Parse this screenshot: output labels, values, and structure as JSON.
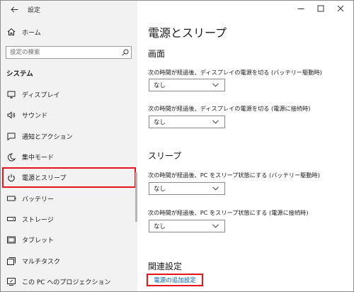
{
  "window": {
    "title": "設定"
  },
  "sidebar": {
    "home_label": "ホーム",
    "search_placeholder": "設定の検索",
    "section_heading": "システム",
    "items": [
      {
        "label": "ディスプレイ",
        "icon": "display-icon"
      },
      {
        "label": "サウンド",
        "icon": "speaker-icon"
      },
      {
        "label": "通知とアクション",
        "icon": "notification-icon"
      },
      {
        "label": "集中モード",
        "icon": "moon-icon"
      },
      {
        "label": "電源とスリープ",
        "icon": "power-icon",
        "selected": true
      },
      {
        "label": "バッテリー",
        "icon": "battery-icon"
      },
      {
        "label": "ストレージ",
        "icon": "storage-icon"
      },
      {
        "label": "タブレット",
        "icon": "tablet-icon"
      },
      {
        "label": "マルチタスク",
        "icon": "multitask-icon"
      },
      {
        "label": "この PC へのプロジェクション",
        "icon": "projection-icon"
      }
    ]
  },
  "main": {
    "page_title": "電源とスリープ",
    "screen_section": {
      "title": "画面",
      "battery_label": "次の時間が経過後、ディスプレイの電源を切る (バッテリー駆動時)",
      "battery_value": "なし",
      "plugged_label": "次の時間が経過後、ディスプレイの電源を切る (電源に接続時)",
      "plugged_value": "なし"
    },
    "sleep_section": {
      "title": "スリープ",
      "battery_label": "次の時間が経過後、PC をスリープ状態にする (バッテリー駆動時)",
      "battery_value": "なし",
      "plugged_label": "次の時間が経過後、PC をスリープ状態にする (電源に接続時)",
      "plugged_value": "なし"
    },
    "related": {
      "title": "関連設定",
      "link_label": "電源の追加設定"
    }
  },
  "colors": {
    "highlight": "#e8141b",
    "link": "#0063b1",
    "sidebar_bg": "#f2f2f2"
  }
}
